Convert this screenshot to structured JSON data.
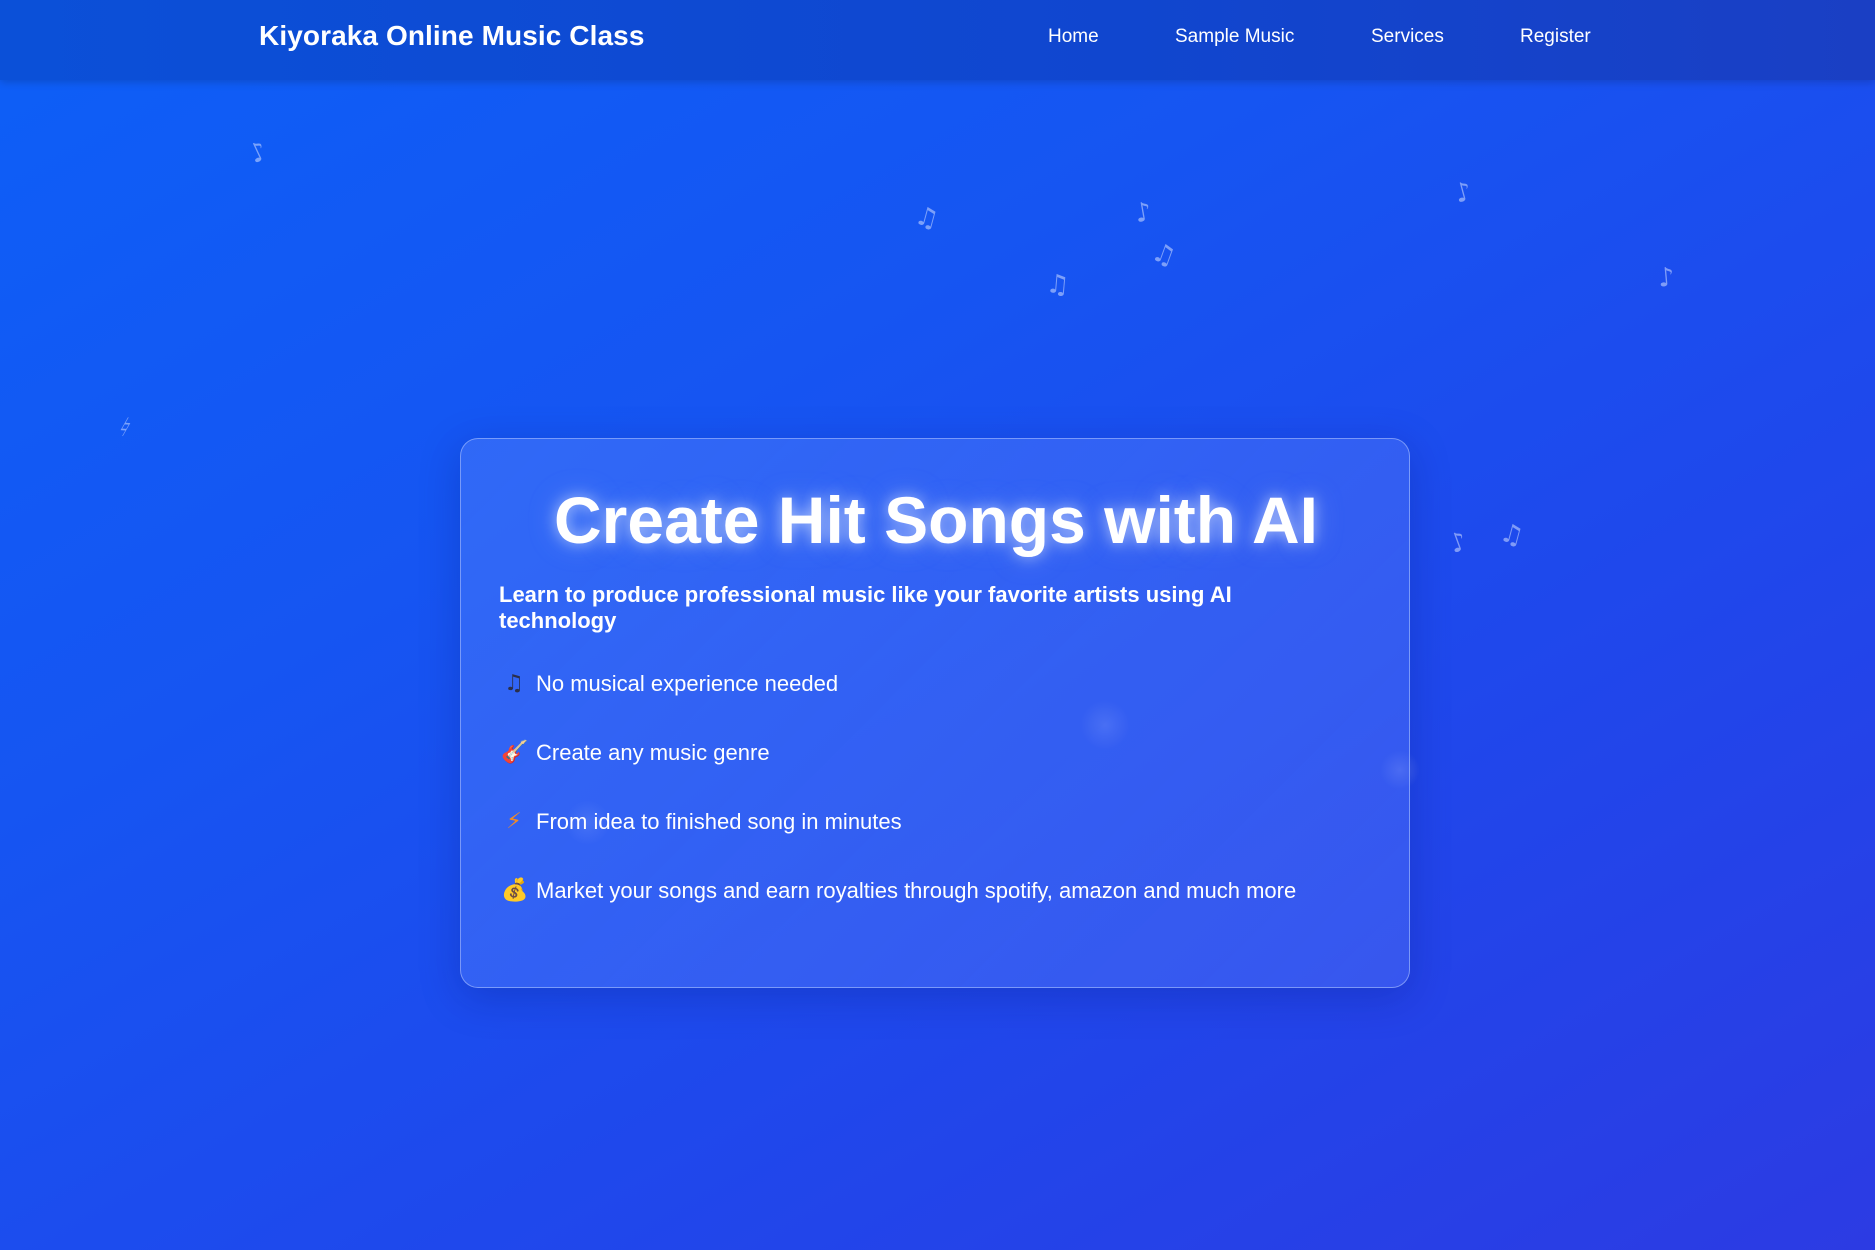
{
  "header": {
    "brand": "Kiyoraka Online Music Class",
    "nav": [
      {
        "label": "Home"
      },
      {
        "label": "Sample Music"
      },
      {
        "label": "Services"
      },
      {
        "label": "Register"
      }
    ]
  },
  "hero": {
    "title": "Create Hit Songs with AI",
    "subtitle": "Learn to produce professional music like your favorite artists using AI technology",
    "features": [
      {
        "icon": "music-note-icon",
        "glyph": "♫",
        "text": "No musical experience needed"
      },
      {
        "icon": "guitar-icon",
        "glyph": "🎸",
        "text": "Create any music genre"
      },
      {
        "icon": "lightning-icon",
        "glyph": "⚡",
        "text": "From idea to finished song in minutes"
      },
      {
        "icon": "money-bag-icon",
        "glyph": "💰",
        "text": "Market your songs and earn royalties through spotify, amazon and much more"
      }
    ]
  },
  "colors": {
    "background_start": "#0d5ff7",
    "background_end": "#2c3be3",
    "navbar": "#0b50d8",
    "text": "#ffffff"
  }
}
